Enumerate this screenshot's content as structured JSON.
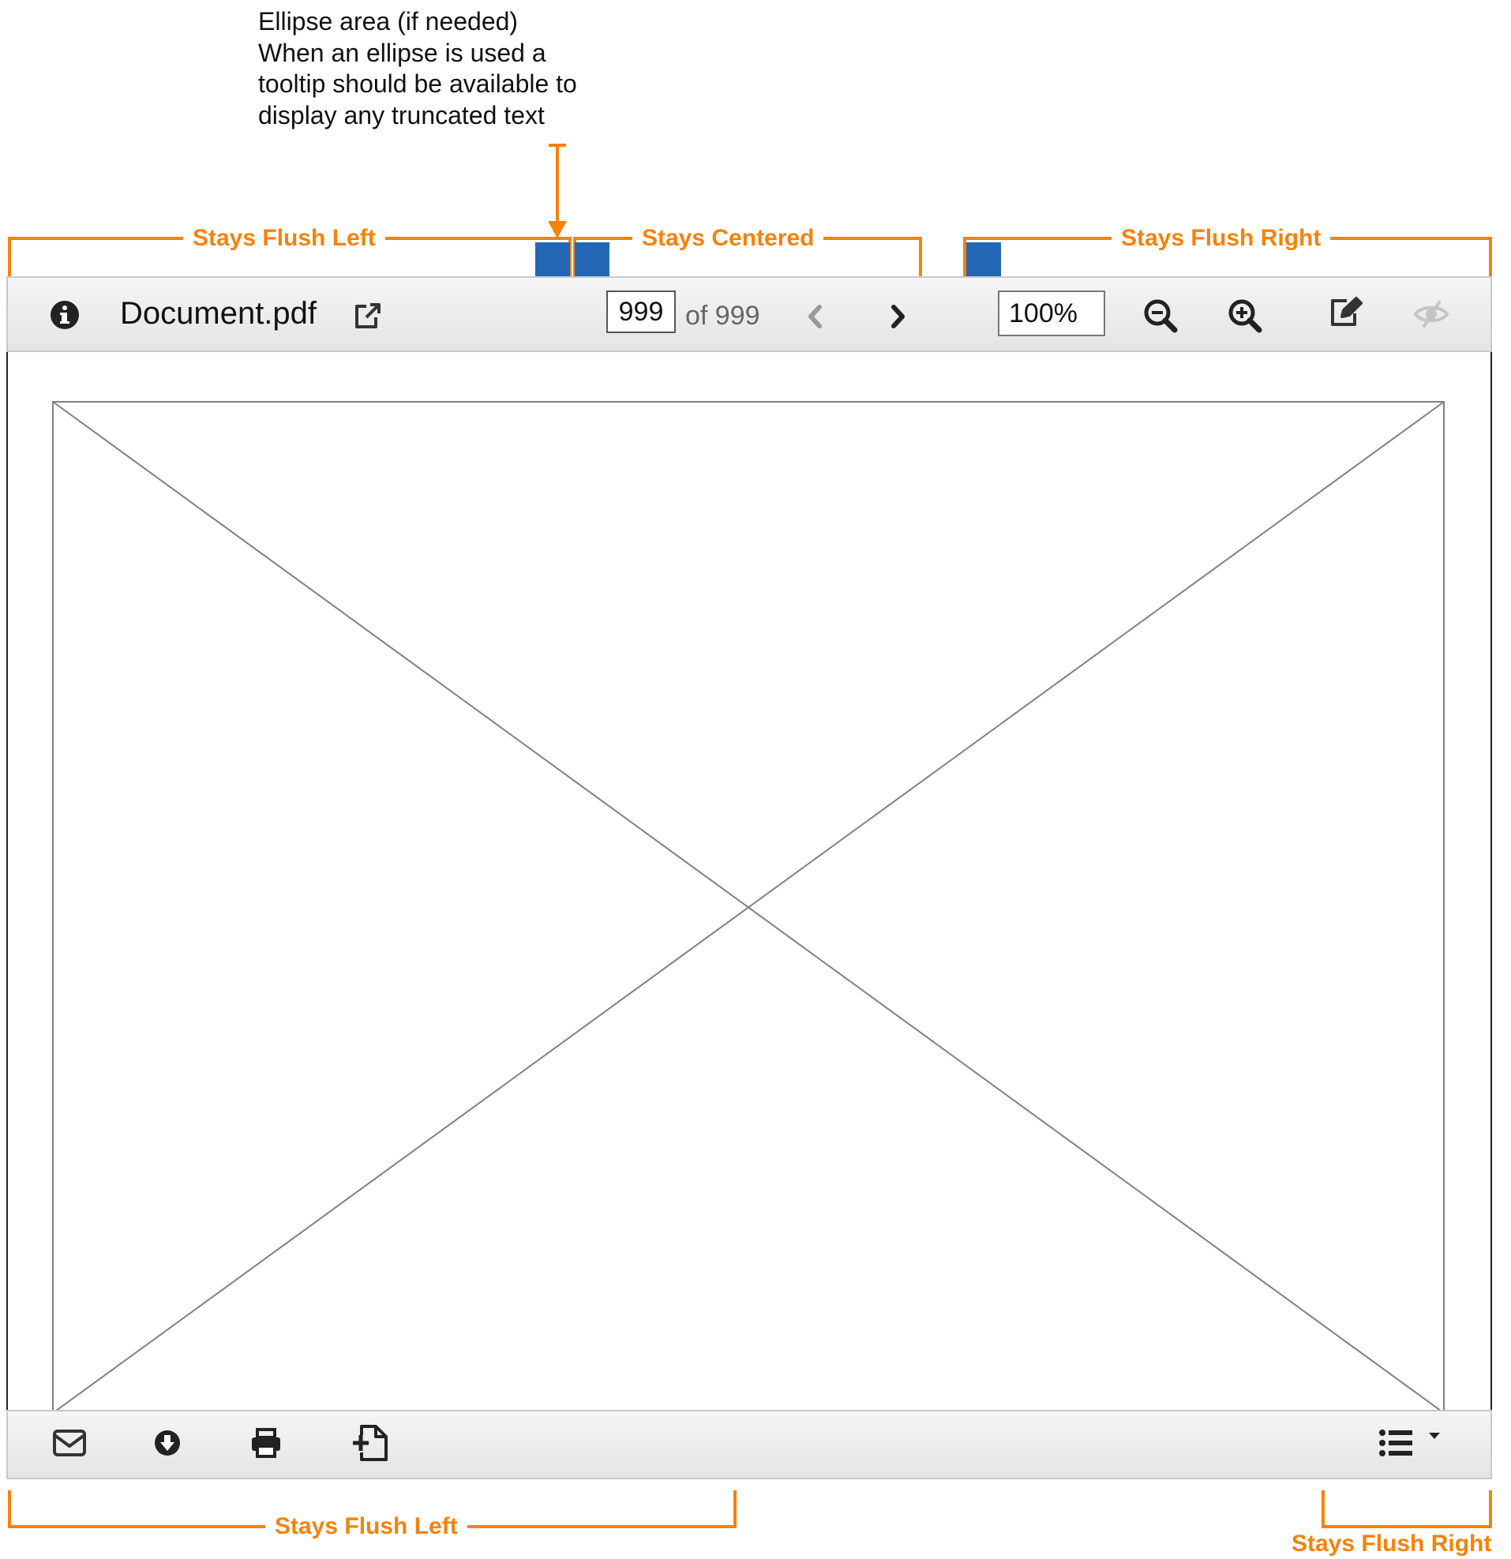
{
  "annotations": {
    "ellipse_note": [
      "Ellipse area (if needed)",
      "When an ellipse is used a",
      "tooltip should be available to",
      "display any truncated text"
    ],
    "top_left": "Stays Flush Left",
    "top_center": "Stays Centered",
    "top_right": "Stays Flush Right",
    "bottom_left": "Stays Flush Left",
    "bottom_right": "Stays Flush Right"
  },
  "colors": {
    "annotation": "#F5820A",
    "placeholder_block": "#2468B5",
    "toolbar_bg": "#ECECEC"
  },
  "toolbar": {
    "info_icon": "info-circle-icon",
    "document_name": "Document.pdf",
    "open_external_icon": "external-link-icon",
    "page_current": "999",
    "page_total": "of 999",
    "prev_icon": "chevron-left-icon",
    "next_icon": "chevron-right-icon",
    "zoom_value": "100%",
    "zoom_out_icon": "zoom-out-icon",
    "zoom_in_icon": "zoom-in-icon",
    "annotate_icon": "edit-icon",
    "hide_icon": "eye-slash-icon"
  },
  "content": {
    "placeholder": "image-placeholder"
  },
  "bottombar": {
    "email_icon": "envelope-icon",
    "download_icon": "download-circle-icon",
    "print_icon": "print-icon",
    "add_file_icon": "add-file-icon",
    "list_menu_icon": "list-dropdown-icon"
  }
}
